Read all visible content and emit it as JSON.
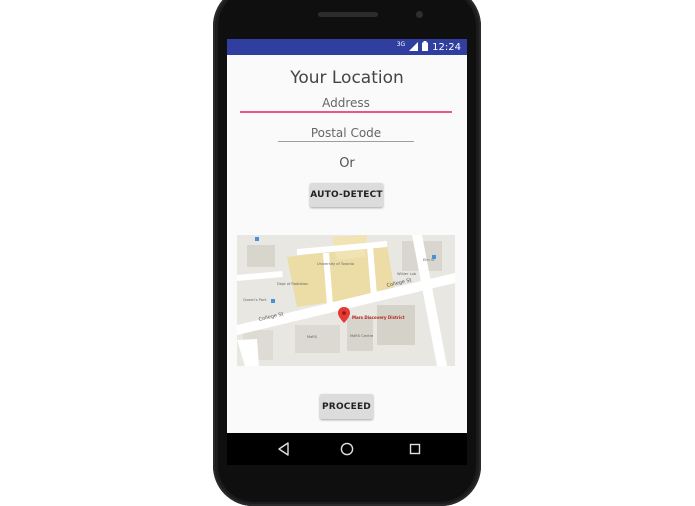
{
  "status_bar": {
    "network": "3G",
    "time": "12:24",
    "color": "#303f9f"
  },
  "screen": {
    "title": "Your Location",
    "address_placeholder": "Address",
    "postal_placeholder": "Postal Code",
    "or_label": "Or",
    "auto_detect_label": "AUTO-DETECT",
    "proceed_label": "PROCEED",
    "accent_color": "#e8587f"
  },
  "map": {
    "street_college": "College St",
    "marker_label": "Mars Discovery District",
    "poi_1": "University of Toronto",
    "poi_2": "Dept of Radiation",
    "poi_3": "Wilder Lab",
    "poi_4": "MaRS",
    "poi_5": "MaRS Centre",
    "poi_6": "Elm St",
    "poi_7": "Queen's Park"
  },
  "nav_bar": {
    "back_icon": "triangle-back-icon",
    "home_icon": "circle-home-icon",
    "recents_icon": "square-recents-icon"
  }
}
